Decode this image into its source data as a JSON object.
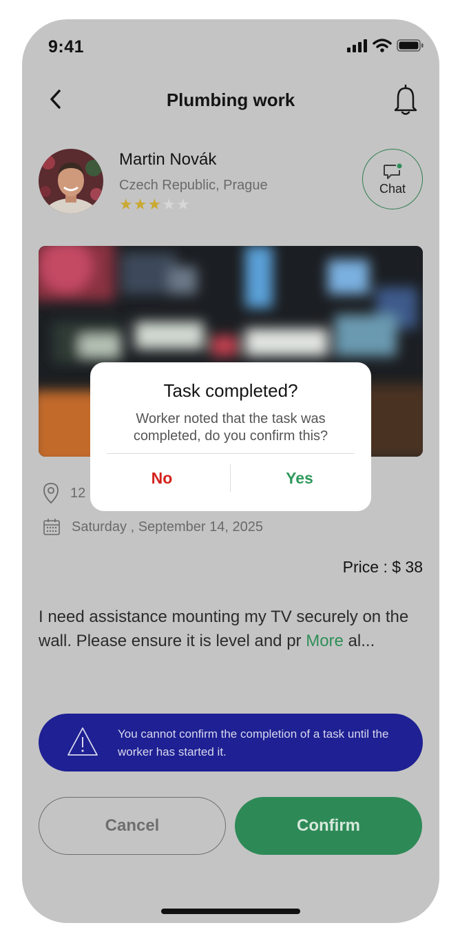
{
  "status_bar": {
    "time": "9:41"
  },
  "header": {
    "title": "Plumbing work"
  },
  "worker": {
    "name": "Martin Novák",
    "location": "Czech Republic, Prague",
    "rating": 3,
    "rating_max": 5,
    "chat_label": "Chat"
  },
  "task": {
    "address_partial": "12",
    "date": "Saturday , September 14, 2025",
    "price": "Price : $ 38",
    "description": "I need assistance mounting my TV securely on the wall. Please ensure it is level and pr",
    "more_label": "More",
    "description_tail": " al..."
  },
  "warning": {
    "text": "You cannot confirm the completion of a task until the worker has started it."
  },
  "actions": {
    "cancel_label": "Cancel",
    "confirm_label": "Confirm"
  },
  "dialog": {
    "title": "Task completed?",
    "message": "Worker noted that the task was completed, do you confirm this?",
    "no_label": "No",
    "yes_label": "Yes"
  },
  "colors": {
    "overlay_background": "#c4c4c4",
    "accent_green": "#2d8a57",
    "warning_blue": "#1e2093",
    "no_red": "#d4221c",
    "star_gold": "#c9a931"
  },
  "icons": [
    "back-chevron-icon",
    "bell-icon",
    "chat-icon",
    "location-pin-icon",
    "calendar-icon",
    "warning-triangle-icon",
    "signal-icon",
    "wifi-icon",
    "battery-icon"
  ]
}
